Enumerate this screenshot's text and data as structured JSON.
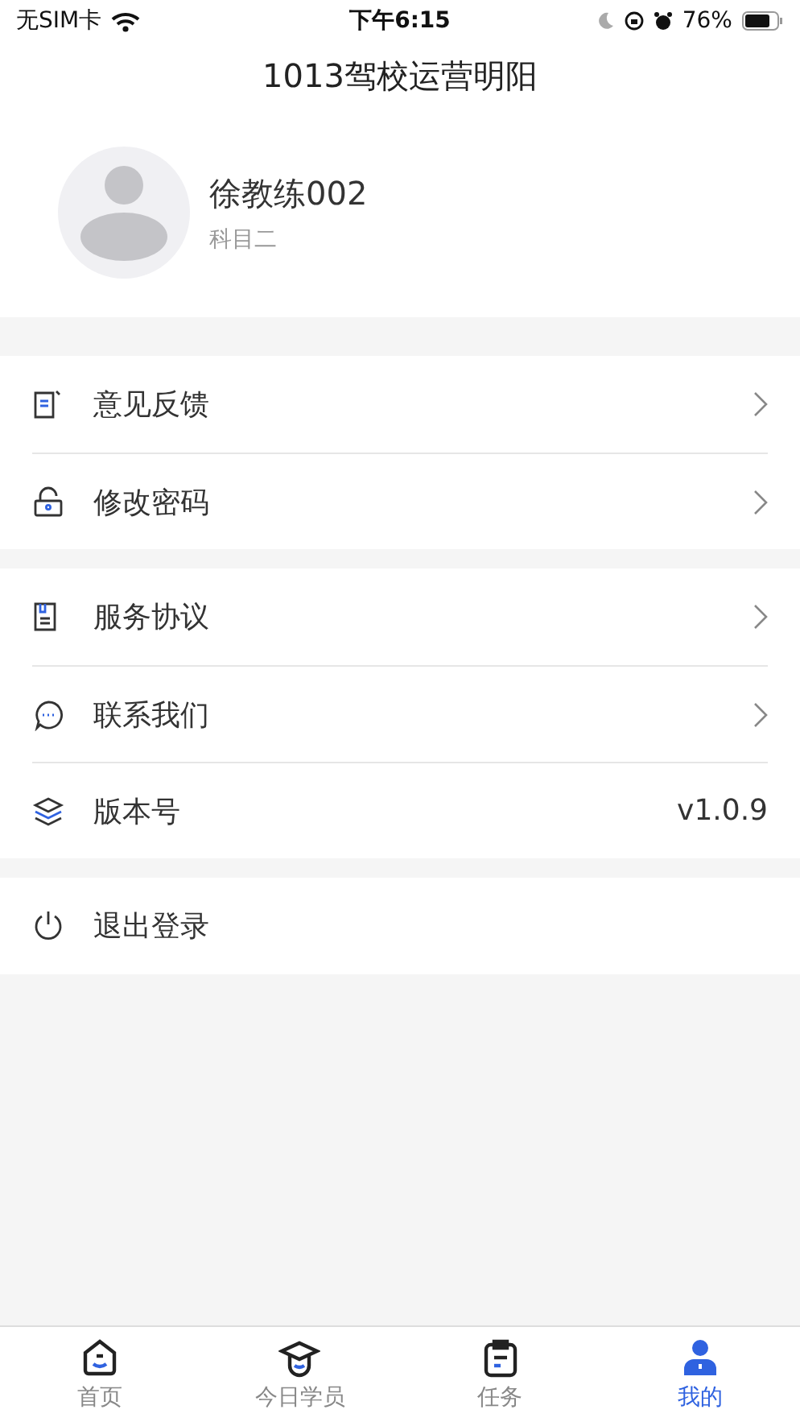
{
  "status_bar": {
    "carrier": "无SIM卡",
    "time": "下午6:15",
    "battery": "76%"
  },
  "header": {
    "title": "1013驾校运营明阳"
  },
  "profile": {
    "name": "徐教练002",
    "subject": "科目二"
  },
  "menu_groups": [
    {
      "items": [
        {
          "label": "意见反馈",
          "kind": "link"
        },
        {
          "label": "修改密码",
          "kind": "link"
        }
      ]
    },
    {
      "items": [
        {
          "label": "服务协议",
          "kind": "link"
        },
        {
          "label": "联系我们",
          "kind": "link"
        },
        {
          "label": "版本号",
          "kind": "value",
          "value": "v1.0.9"
        }
      ]
    },
    {
      "items": [
        {
          "label": "退出登录",
          "kind": "plain"
        }
      ]
    }
  ],
  "tab_bar": [
    {
      "label": "首页",
      "selected": false
    },
    {
      "label": "今日学员",
      "selected": false
    },
    {
      "label": "任务",
      "selected": false
    },
    {
      "label": "我的",
      "selected": true
    }
  ]
}
